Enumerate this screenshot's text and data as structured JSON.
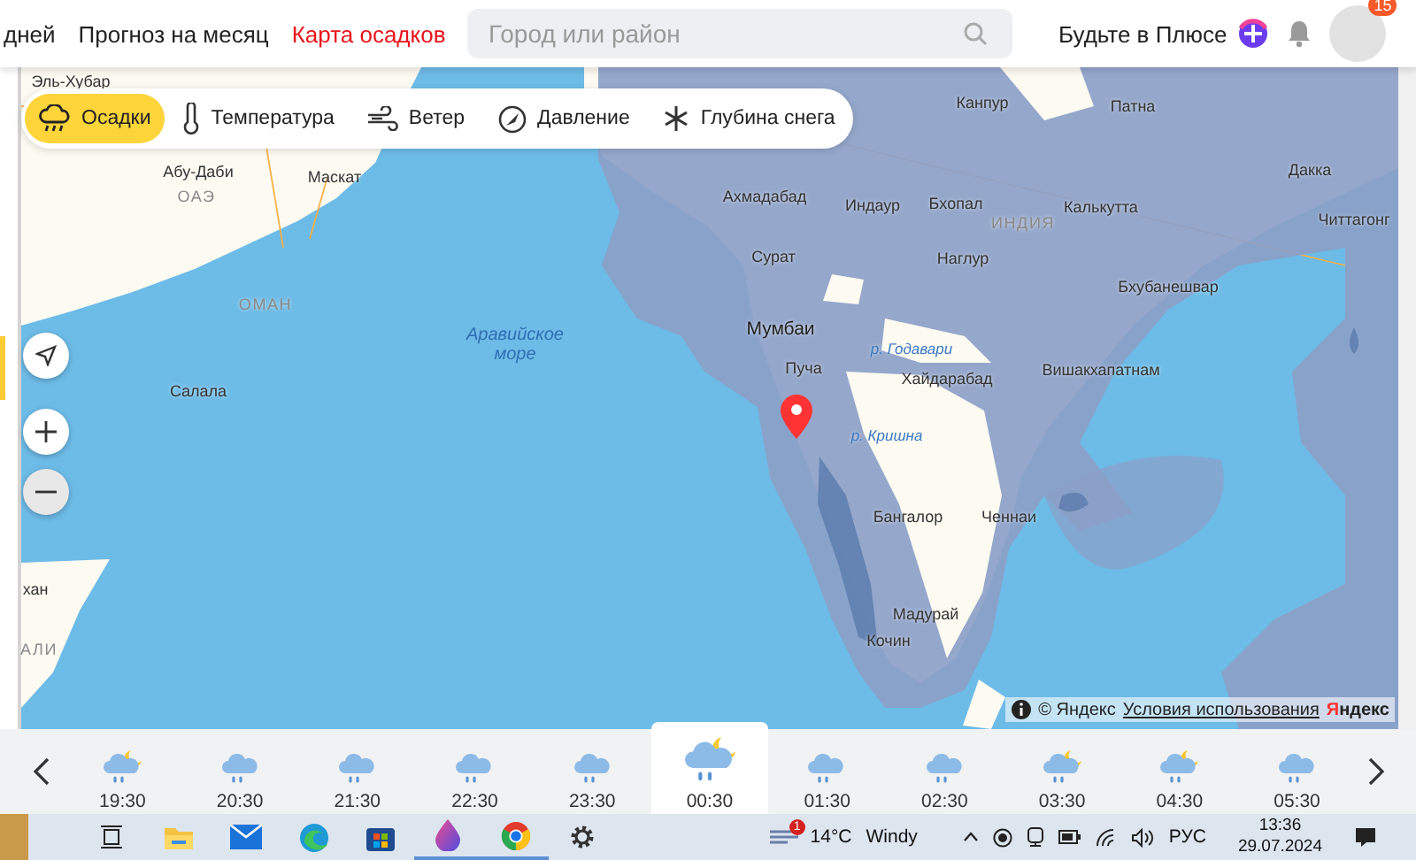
{
  "header": {
    "nav": [
      {
        "label": "дней",
        "selected": false
      },
      {
        "label": "Прогноз на месяц",
        "selected": false
      },
      {
        "label": "Карта осадков",
        "selected": true
      }
    ],
    "search": {
      "placeholder": "Город или район"
    },
    "plus_label": "Будьте в Плюсе",
    "avatar_badge": "15"
  },
  "layers": [
    {
      "label": "Осадки",
      "kind": "precipitation",
      "selected": true
    },
    {
      "label": "Температура",
      "kind": "temperature",
      "selected": false
    },
    {
      "label": "Ветер",
      "kind": "wind",
      "selected": false
    },
    {
      "label": "Давление",
      "kind": "pressure",
      "selected": false
    },
    {
      "label": "Глубина снега",
      "kind": "snow",
      "selected": false
    }
  ],
  "map": {
    "labels": [
      {
        "text": "Эль-Хубар",
        "kind": "city"
      },
      {
        "text": "Абу-Даби",
        "kind": "city"
      },
      {
        "text": "ОАЭ",
        "kind": "country"
      },
      {
        "text": "Маскат",
        "kind": "city"
      },
      {
        "text": "ОМАН",
        "kind": "country"
      },
      {
        "text": "Салала",
        "kind": "city"
      },
      {
        "text": "Аравийское море",
        "kind": "sea"
      },
      {
        "text": "Ахмадабад",
        "kind": "city"
      },
      {
        "text": "Индаур",
        "kind": "city"
      },
      {
        "text": "Бхопал",
        "kind": "city"
      },
      {
        "text": "ИНДИЯ",
        "kind": "country"
      },
      {
        "text": "Калькутта",
        "kind": "city"
      },
      {
        "text": "Дакка",
        "kind": "city"
      },
      {
        "text": "Читтагонг",
        "kind": "city"
      },
      {
        "text": "Сурат",
        "kind": "city"
      },
      {
        "text": "Наглур",
        "kind": "city"
      },
      {
        "text": "Бхубанешвар",
        "kind": "city"
      },
      {
        "text": "Мумбаи",
        "kind": "capital"
      },
      {
        "text": "р. Годавари",
        "kind": "river"
      },
      {
        "text": "Пуча",
        "kind": "city"
      },
      {
        "text": "Хайдарабад",
        "kind": "city"
      },
      {
        "text": "Вишакхапатнам",
        "kind": "city"
      },
      {
        "text": "р. Кришна",
        "kind": "river"
      },
      {
        "text": "Бангалор",
        "kind": "city"
      },
      {
        "text": "Ченнаи",
        "kind": "city"
      },
      {
        "text": "Мадурай",
        "kind": "city"
      },
      {
        "text": "Кочин",
        "kind": "city"
      },
      {
        "text": "Канпур",
        "kind": "city"
      },
      {
        "text": "Патна",
        "kind": "city"
      },
      {
        "text": "хан",
        "kind": "city"
      },
      {
        "text": "АЛИ",
        "kind": "country"
      }
    ],
    "copyright": "© Яндекс",
    "terms_link": "Условия использования",
    "logo": "Яндекс"
  },
  "timeline": [
    {
      "time": "19:30",
      "kind": "night-rain",
      "selected": false
    },
    {
      "time": "20:30",
      "kind": "rain",
      "selected": false
    },
    {
      "time": "21:30",
      "kind": "rain",
      "selected": false
    },
    {
      "time": "22:30",
      "kind": "rain",
      "selected": false
    },
    {
      "time": "23:30",
      "kind": "rain",
      "selected": false
    },
    {
      "time": "00:30",
      "kind": "night-rain",
      "selected": true
    },
    {
      "time": "01:30",
      "kind": "rain",
      "selected": false
    },
    {
      "time": "02:30",
      "kind": "rain",
      "selected": false
    },
    {
      "time": "03:30",
      "kind": "night-rain",
      "selected": false
    },
    {
      "time": "04:30",
      "kind": "night-rain",
      "selected": false
    },
    {
      "time": "05:30",
      "kind": "rain",
      "selected": false
    }
  ],
  "taskbar": {
    "weather_badge": "1",
    "temperature": "14°C",
    "condition": "Windy",
    "language": "РУС",
    "time": "13:36",
    "date": "29.07.2024"
  }
}
